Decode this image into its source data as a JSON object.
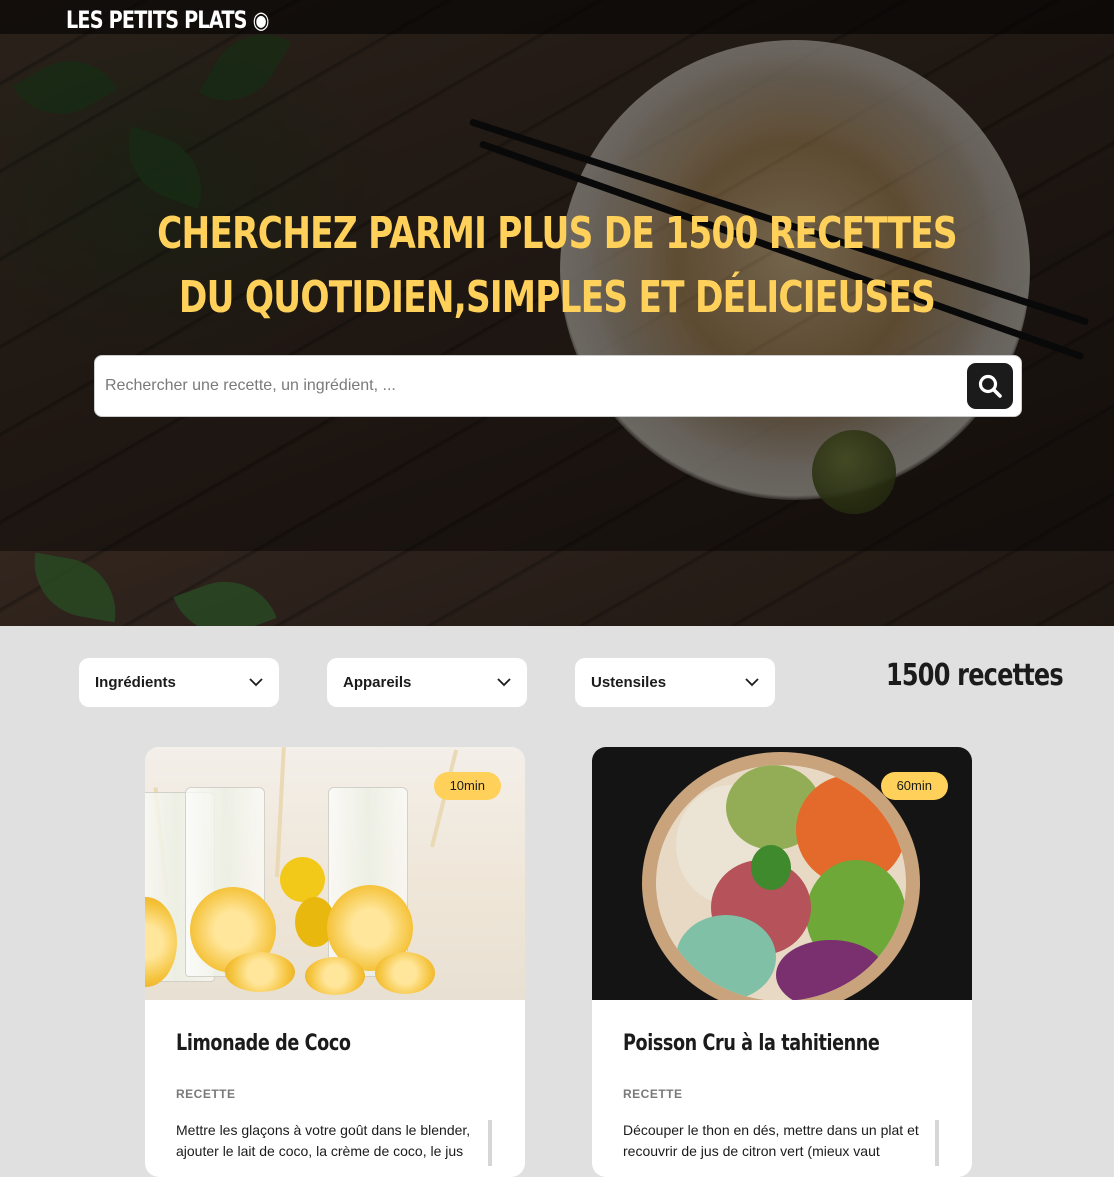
{
  "header": {
    "logo": "LES PETITS PLATS ◉"
  },
  "hero": {
    "headline_line1": "CHERCHEZ PARMI PLUS DE 1500 RECETTES",
    "headline_line2": "DU QUOTIDIEN,SIMPLES ET DÉLICIEUSES"
  },
  "search": {
    "placeholder": "Rechercher une recette, un ingrédient, ...",
    "button_icon": "search-icon"
  },
  "filters": [
    {
      "label": "Ingrédients",
      "icon": "chevron-down-icon"
    },
    {
      "label": "Appareils",
      "icon": "chevron-down-icon"
    },
    {
      "label": "Ustensiles",
      "icon": "chevron-down-icon"
    }
  ],
  "recipe_count": "1500 recettes",
  "recipes": [
    {
      "title": "Limonade de Coco",
      "time": "10min",
      "section": "RECETTE",
      "description": "Mettre les glaçons à votre goût dans le blender, ajouter le lait de coco, la crème de coco, le jus"
    },
    {
      "title": "Poisson Cru à la tahitienne",
      "time": "60min",
      "section": "RECETTE",
      "description": "Découper le thon en dés, mettre dans un plat et recouvrir de jus de citron vert (mieux vaut"
    }
  ],
  "colors": {
    "accent": "#ffd15b",
    "dark": "#1b1b1b",
    "page_bg": "#e0e0e0"
  }
}
